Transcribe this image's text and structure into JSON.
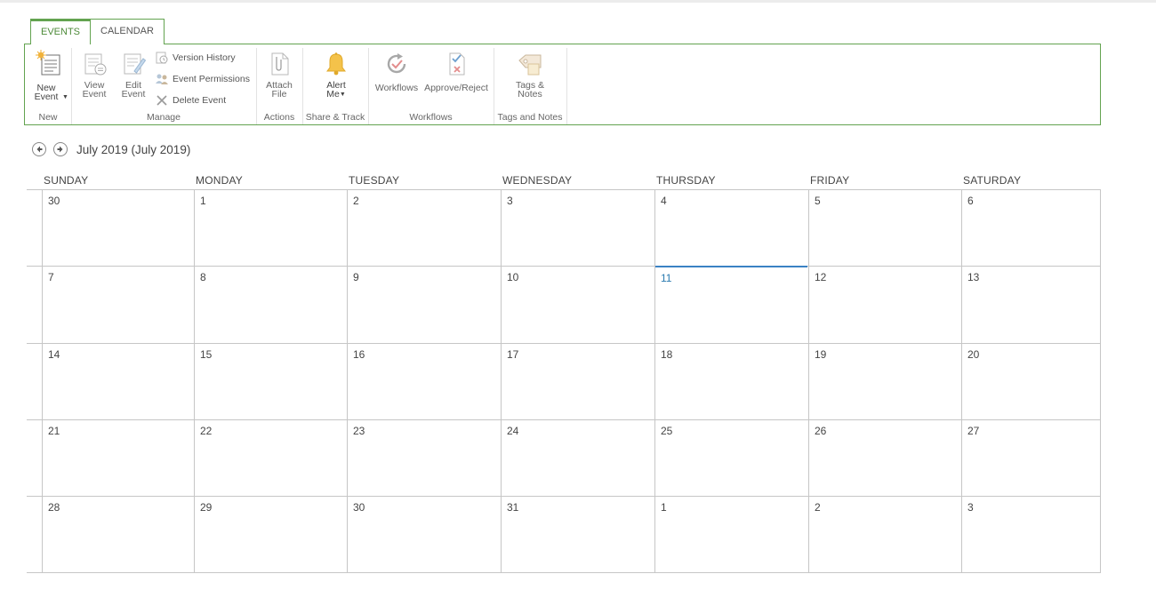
{
  "tabs": [
    "EVENTS",
    "CALENDAR"
  ],
  "ribbon": {
    "new": {
      "button": "New Event",
      "group": "New"
    },
    "manage": {
      "view": "View Event",
      "edit": "Edit Event",
      "version_history": "Version History",
      "event_permissions": "Event Permissions",
      "delete_event": "Delete Event",
      "group": "Manage"
    },
    "actions": {
      "attach": "Attach File",
      "group": "Actions"
    },
    "share": {
      "alert": "Alert Me",
      "group": "Share & Track"
    },
    "workflows": {
      "workflows": "Workflows",
      "approve": "Approve/Reject",
      "group": "Workflows"
    },
    "tags": {
      "tags": "Tags & Notes",
      "group": "Tags and Notes"
    }
  },
  "calendar": {
    "title": "July 2019 (July 2019)",
    "days": [
      "SUNDAY",
      "MONDAY",
      "TUESDAY",
      "WEDNESDAY",
      "THURSDAY",
      "FRIDAY",
      "SATURDAY"
    ],
    "weeks": [
      [
        "30",
        "1",
        "2",
        "3",
        "4",
        "5",
        "6"
      ],
      [
        "7",
        "8",
        "9",
        "10",
        "11",
        "12",
        "13"
      ],
      [
        "14",
        "15",
        "16",
        "17",
        "18",
        "19",
        "20"
      ],
      [
        "21",
        "22",
        "23",
        "24",
        "25",
        "26",
        "27"
      ],
      [
        "28",
        "29",
        "30",
        "31",
        "1",
        "2",
        "3"
      ]
    ],
    "today": "11",
    "accent_color": "#63a350",
    "today_color": "#2a7ab0"
  }
}
